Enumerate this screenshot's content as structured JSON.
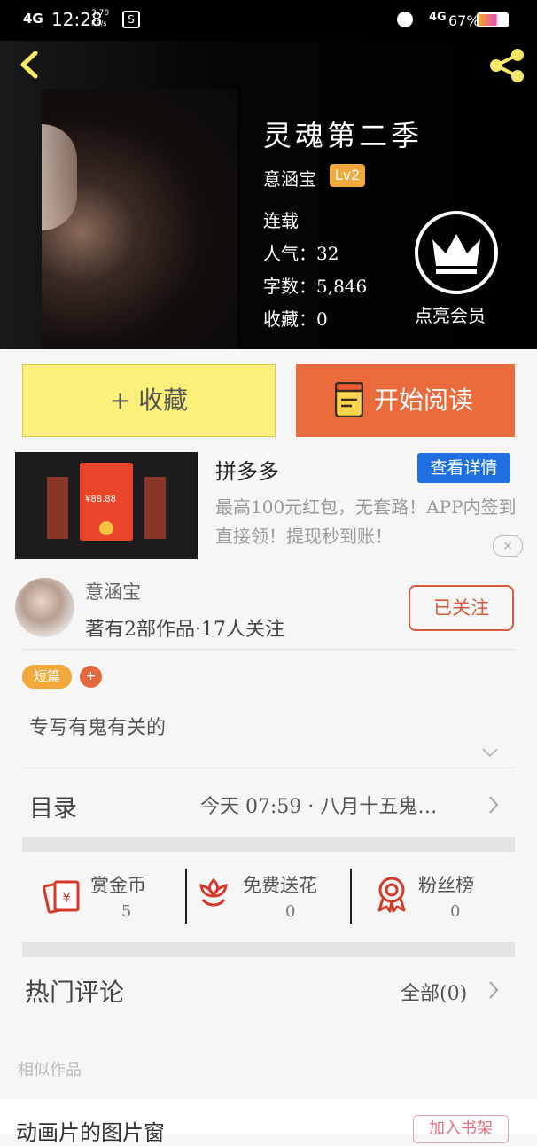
{
  "status_bar": {
    "network": "4G",
    "time": "12:28",
    "speed_top": "3.70",
    "speed_unit": "KB/s",
    "network_right": "4G",
    "battery": "67%"
  },
  "book": {
    "title": "灵魂第二季",
    "author": "意涵宝",
    "level": "Lv2",
    "status": "连载",
    "popularity": "人气：32",
    "word_count": "字数：5,846",
    "collections": "收藏：0",
    "vip_label": "点亮会员"
  },
  "actions": {
    "collect": "+ 收藏",
    "read": "开始阅读"
  },
  "ad": {
    "title": "拼多多",
    "detail_button": "查看详情",
    "description": "最高100元红包，无套路！APP内签到直接领！提现秒到账！",
    "close": "×",
    "packet_amount": "¥88.88"
  },
  "author_section": {
    "name": "意涵宝",
    "stats": "著有2部作品·17人关注",
    "follow": "已关注"
  },
  "tags": {
    "genre": "短篇",
    "add": "+"
  },
  "synopsis": "专写有鬼有关的",
  "toc": {
    "label": "目录",
    "latest": "今天 07:59 · 八月十五鬼…"
  },
  "stats": {
    "coins_title": "赏金币",
    "coins_value": "5",
    "flowers_title": "免费送花",
    "flowers_value": "0",
    "fans_title": "粉丝榜",
    "fans_value": "0"
  },
  "comments": {
    "label": "热门评论",
    "all": "全部(0)"
  },
  "similar": {
    "label": "相似作品",
    "first_title": "动画片的图片窗",
    "add_shelf": "加入书架"
  },
  "colors": {
    "collect_bg": "#fdf07a",
    "read_bg": "#ea6a3b",
    "badge_orange": "#f2a93b",
    "ad_blue": "#1f6fe0",
    "accent_red": "#d85a3a"
  }
}
